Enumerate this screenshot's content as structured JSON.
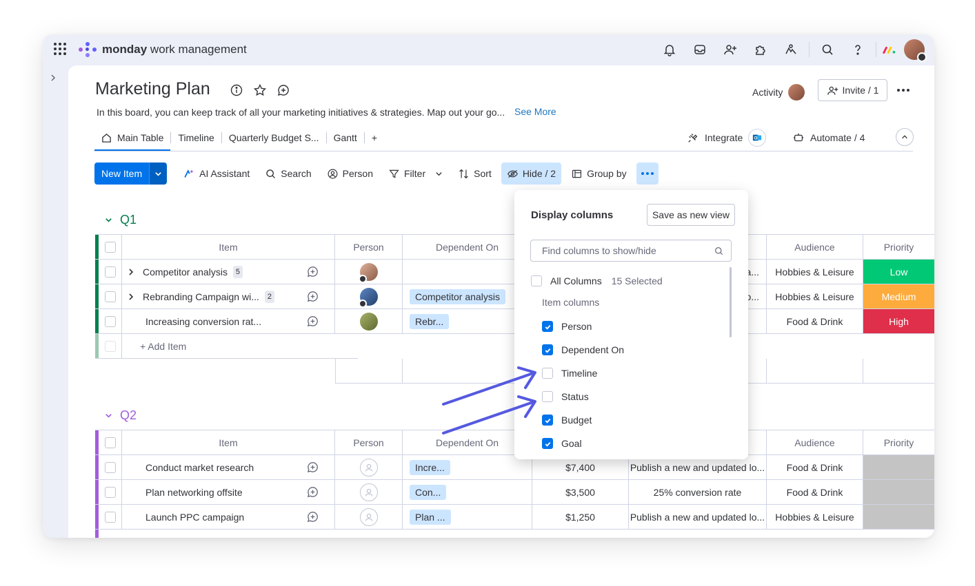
{
  "brand": {
    "logo_bold": "monday",
    "logo_rest": " work management"
  },
  "board": {
    "title": "Marketing Plan",
    "description": "In this board, you can keep track of all your marketing initiatives & strategies. Map out your go...",
    "see_more": "See More",
    "activity_label": "Activity",
    "invite_label": "Invite / 1"
  },
  "tabs": [
    {
      "label": "Main Table",
      "active": true
    },
    {
      "label": "Timeline"
    },
    {
      "label": "Quarterly Budget S..."
    },
    {
      "label": "Gantt"
    },
    {
      "label": "+"
    }
  ],
  "header_actions": {
    "integrate": "Integrate",
    "automate": "Automate / 4"
  },
  "toolbar": {
    "new_item": "New Item",
    "ai": "AI Assistant",
    "search": "Search",
    "person": "Person",
    "filter": "Filter",
    "sort": "Sort",
    "hide": "Hide / 2",
    "group_by": "Group by"
  },
  "columns": {
    "item": "Item",
    "person": "Person",
    "dependent_on": "Dependent On",
    "audience": "Audience",
    "priority": "Priority"
  },
  "colors": {
    "accent": "#0073ea",
    "q1": "#037f4c",
    "q2": "#a25ddc",
    "low": "#00c875",
    "medium": "#fdab3d",
    "high": "#df2f4a",
    "arrow": "#5559df"
  },
  "groups": [
    {
      "name": "Q1",
      "rows": [
        {
          "item": "Competitor analysis",
          "count": "5",
          "dependent": "",
          "goal_tail": "a...",
          "audience": "Hobbies & Leisure",
          "priority": "Low"
        },
        {
          "item": "Rebranding Campaign wi...",
          "count": "2",
          "dependent": "Competitor analysis",
          "goal_tail": "o...",
          "audience": "Hobbies & Leisure",
          "priority": "Medium"
        },
        {
          "item": "Increasing conversion rat...",
          "count": "",
          "dependent": "Rebr...",
          "goal_tail": "",
          "audience": "Food & Drink",
          "priority": "High"
        }
      ],
      "add_item": "+ Add Item"
    },
    {
      "name": "Q2",
      "rows": [
        {
          "item": "Conduct market research",
          "dependent": "Incre...",
          "budget": "$7,400",
          "goal": "Publish a new and updated lo...",
          "audience": "Food & Drink"
        },
        {
          "item": "Plan networking offsite",
          "dependent": "Con...",
          "budget": "$3,500",
          "goal": "25% conversion rate",
          "audience": "Food & Drink"
        },
        {
          "item": "Launch PPC campaign",
          "dependent": "Plan ...",
          "budget": "$1,250",
          "goal": "Publish a new and updated lo...",
          "audience": "Hobbies & Leisure"
        }
      ]
    }
  ],
  "popup": {
    "title": "Display columns",
    "save_view": "Save as new view",
    "find_placeholder": "Find columns to show/hide",
    "all_columns": "All Columns",
    "selected": "15 Selected",
    "section": "Item columns",
    "options": [
      {
        "label": "Person",
        "checked": true
      },
      {
        "label": "Dependent On",
        "checked": true
      },
      {
        "label": "Timeline",
        "checked": false
      },
      {
        "label": "Status",
        "checked": false
      },
      {
        "label": "Budget",
        "checked": true
      },
      {
        "label": "Goal",
        "checked": true
      }
    ]
  }
}
